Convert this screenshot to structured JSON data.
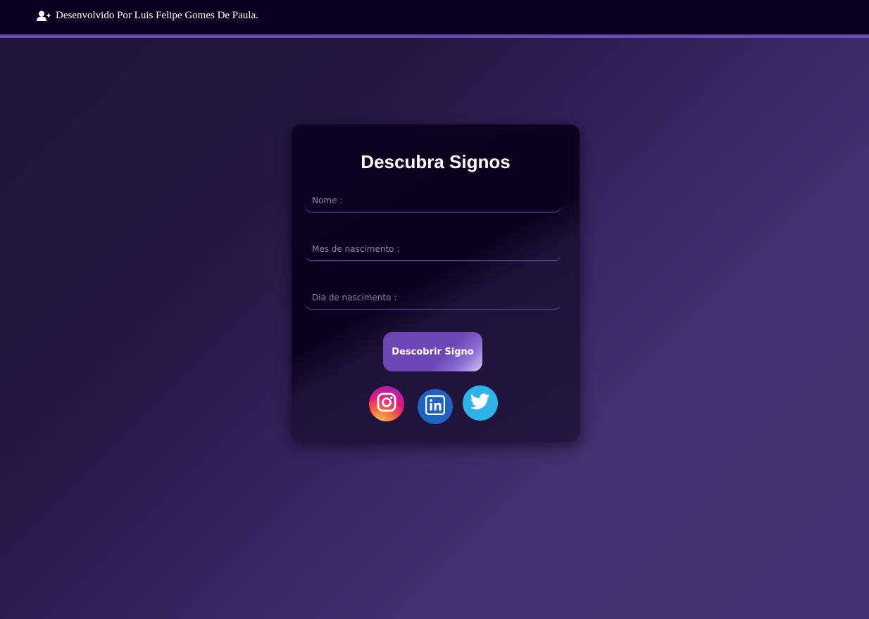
{
  "header": {
    "credit_text": "Desenvolvido Por Luis Felipe Gomes De Paula.",
    "icon": "user-plus-icon"
  },
  "card": {
    "title": "Descubra Signos",
    "fields": [
      {
        "name": "name-field",
        "placeholder": "Nome :",
        "value": ""
      },
      {
        "name": "month-field",
        "placeholder": "Mes de nascimento :",
        "value": ""
      },
      {
        "name": "day-field",
        "placeholder": "Dia de nascimento :",
        "value": ""
      }
    ],
    "submit_label": "Descobrir Signo",
    "social": [
      {
        "name": "instagram-icon",
        "color": "#e21b79"
      },
      {
        "name": "linkedin-icon",
        "color": "#1f63c0"
      },
      {
        "name": "twitter-icon",
        "color": "#2fb2e6"
      }
    ]
  },
  "colors": {
    "topbar": "#0b0220",
    "accent": "#6a4bb4",
    "button": "#6a47b5"
  }
}
